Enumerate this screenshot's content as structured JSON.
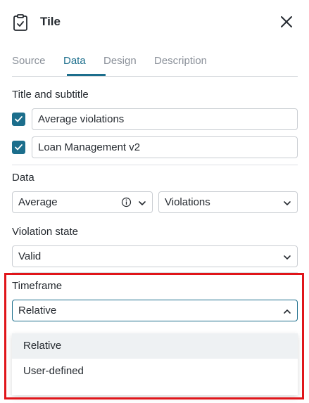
{
  "header": {
    "title": "Tile",
    "icon": "clipboard-check-icon",
    "close_icon": "close-icon"
  },
  "tabs": [
    {
      "label": "Source",
      "active": false
    },
    {
      "label": "Data",
      "active": true
    },
    {
      "label": "Design",
      "active": false
    },
    {
      "label": "Description",
      "active": false
    }
  ],
  "title_subtitle": {
    "label": "Title and subtitle",
    "title_value": "Average violations",
    "title_checked": true,
    "subtitle_value": "Loan Management v2",
    "subtitle_checked": true
  },
  "data_section": {
    "label": "Data",
    "aggregation": "Average",
    "metric": "Violations"
  },
  "violation_state": {
    "label": "Violation state",
    "value": "Valid"
  },
  "timeframe": {
    "label": "Timeframe",
    "value": "Relative",
    "options": [
      "Relative",
      "User-defined"
    ],
    "hovered_option": "Relative"
  },
  "colors": {
    "accent": "#1c6e8c",
    "highlight_border": "#e0151a"
  }
}
